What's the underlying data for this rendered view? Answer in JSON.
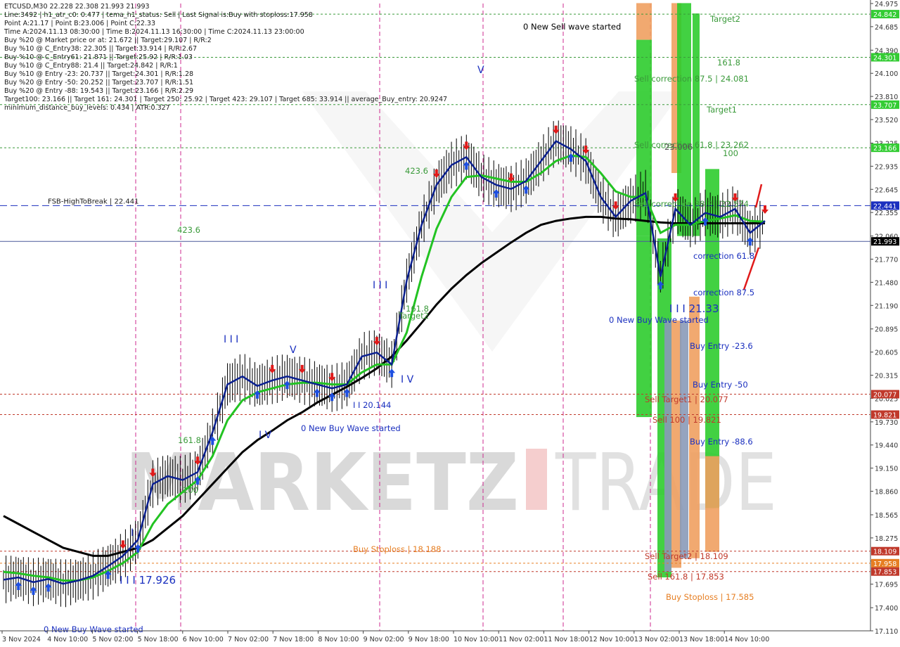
{
  "header": {
    "lines": [
      "ETCUSD,M30  22.228 22.308 21.993 21.993",
      "Line:3492 | h1_atr_c0: 0.477 | tema_h1_status: Sell | Last Signal is:Buy with stoploss:17.958",
      "Point A:21.17 | Point B:23.006 | Point C:22.33",
      "Time A:2024.11.13 08:30:00 | Time B:2024.11.13 16:30:00 | Time C:2024.11.13 23:00:00",
      "Buy %20 @ Market price or at: 21.672 || Target:29.107 | R/R:2",
      "Buy %10 @ C_Entry38: 22.305 || Target:33.914 | R/R:2.67",
      "Buy %10 @ C_Entry61: 21.871 || Target:25.92 | R/R:1.03",
      "Buy %10 @ C_Entry88: 21.4 || Target:24.842 | R/R:1",
      "Buy %10 @ Entry -23: 20.737 || Target:24.301 | R/R:1.28",
      "Buy %20 @ Entry -50: 20.252 || Target:23.707 | R/R:1.51",
      "Buy %20 @ Entry -88: 19.543 || Target:23.166 | R/R:2.29",
      "Target100: 23.166 || Target 161: 24.301 | Target 250: 25.92 | Target 423: 29.107 | Target 685: 33.914 || average_Buy_entry: 20.9247",
      "minimum_distance_buy_levels: 0.434 | ATR:0.327"
    ]
  },
  "chart_data": {
    "type": "line",
    "symbol": "ETCUSD",
    "timeframe": "M30",
    "ylim": [
      17.11,
      24.975
    ],
    "y_ticks": [
      "24.975",
      "24.685",
      "24.390",
      "24.100",
      "23.810",
      "23.520",
      "23.225",
      "22.935",
      "22.645",
      "22.355",
      "22.060",
      "21.770",
      "21.480",
      "21.190",
      "20.895",
      "20.605",
      "20.315",
      "20.025",
      "19.730",
      "19.440",
      "19.150",
      "18.860",
      "18.565",
      "18.275",
      "17.985",
      "17.695",
      "17.400",
      "17.110"
    ],
    "x_labels": [
      "3 Nov 2024",
      "4 Nov 10:00",
      "5 Nov 02:00",
      "5 Nov 18:00",
      "6 Nov 10:00",
      "7 Nov 02:00",
      "7 Nov 18:00",
      "8 Nov 10:00",
      "9 Nov 02:00",
      "9 Nov 18:00",
      "10 Nov 10:00",
      "11 Nov 02:00",
      "11 Nov 18:00",
      "12 Nov 10:00",
      "13 Nov 02:00",
      "13 Nov 18:00",
      "14 Nov 10:00"
    ],
    "series": [
      {
        "values": [
          17.75,
          17.78,
          17.72,
          17.76,
          17.7,
          17.74,
          17.8,
          17.92,
          18.05,
          18.25,
          18.95,
          19.05,
          19.0,
          19.1,
          19.6,
          20.2,
          20.3,
          20.18,
          20.25,
          20.3,
          20.25,
          20.2,
          20.15,
          20.2,
          20.55,
          20.6,
          20.45,
          21.5,
          22.2,
          22.7,
          22.95,
          23.05,
          22.8,
          22.7,
          22.65,
          22.75,
          23.0,
          23.25,
          23.15,
          23.0,
          22.55,
          22.3,
          22.5,
          22.6,
          21.55,
          22.4,
          22.2,
          22.35,
          22.3,
          22.4,
          22.1,
          22.25
        ]
      },
      {
        "values": [
          17.85,
          17.83,
          17.8,
          17.78,
          17.74,
          17.74,
          17.78,
          17.86,
          17.96,
          18.1,
          18.45,
          18.7,
          18.85,
          19.0,
          19.3,
          19.75,
          20.0,
          20.1,
          20.15,
          20.2,
          20.22,
          20.22,
          20.2,
          20.2,
          20.35,
          20.45,
          20.45,
          20.85,
          21.55,
          22.15,
          22.55,
          22.8,
          22.82,
          22.78,
          22.74,
          22.74,
          22.85,
          23.0,
          23.07,
          23.05,
          22.85,
          22.62,
          22.55,
          22.55,
          22.1,
          22.2,
          22.2,
          22.25,
          22.28,
          22.32,
          22.25,
          22.24
        ]
      },
      {
        "values": [
          18.55,
          18.45,
          18.35,
          18.25,
          18.15,
          18.1,
          18.05,
          18.05,
          18.1,
          18.15,
          18.25,
          18.4,
          18.55,
          18.75,
          18.95,
          19.15,
          19.35,
          19.5,
          19.62,
          19.75,
          19.85,
          19.97,
          20.07,
          20.17,
          20.28,
          20.4,
          20.55,
          20.75,
          20.97,
          21.2,
          21.4,
          21.57,
          21.72,
          21.85,
          21.98,
          22.1,
          22.2,
          22.25,
          22.28,
          22.3,
          22.3,
          22.28,
          22.27,
          22.25,
          22.23,
          22.22,
          22.22,
          22.22,
          22.22,
          22.22,
          22.22,
          22.22
        ]
      }
    ],
    "colors": {
      "candles": "#000000",
      "tema": "#0a1f8f",
      "ema_green": "#22c322",
      "sma_black": "#000000",
      "buy_arrow": "#1e4fe0",
      "sell_arrow": "#e01a1a",
      "fib_green": "#2ecc2e",
      "fib_orange": "#f0a060",
      "label_green": "#3a9a3a",
      "label_blue": "#1a2fbf",
      "label_red": "#c0392b"
    },
    "horizontal_levels": [
      {
        "name": "FSB-HighToBreak",
        "value": 22.441,
        "text": "FSB-HighToBreak | 22.441",
        "box": "22.441",
        "color": "#1a2fbf",
        "style": "dashed"
      },
      {
        "value": 21.993,
        "box": "21.993",
        "color": "#4a5a9a",
        "style": "solid",
        "box_bg": "#000000"
      },
      {
        "value": 24.842,
        "box": "24.842",
        "color": "#3a9a3a",
        "style": "dotted",
        "box_bg": "#33cc33"
      },
      {
        "value": 24.301,
        "box": "24.301",
        "color": "#3a9a3a",
        "style": "dotted",
        "box_bg": "#33cc33"
      },
      {
        "value": 23.707,
        "box": "23.707",
        "color": "#3a9a3a",
        "style": "dotted",
        "box_bg": "#33cc33"
      },
      {
        "value": 23.166,
        "box": "23.166",
        "color": "#3a9a3a",
        "style": "dotted",
        "box_bg": "#33cc33"
      },
      {
        "value": 20.077,
        "box": "20.077",
        "color": "#c0392b",
        "style": "dotted",
        "box_bg": "#c0392b"
      },
      {
        "value": 19.821,
        "box": "19.821",
        "color": "#c0392b",
        "style": "dotted",
        "box_bg": "#c0392b"
      },
      {
        "value": 18.109,
        "box": "18.109",
        "color": "#c0392b",
        "style": "dotted",
        "box_bg": "#c0392b"
      },
      {
        "value": 17.958,
        "box": "17.958",
        "color": "#e67e22",
        "style": "dotted",
        "box_bg": "#e67e22"
      },
      {
        "value": 17.853,
        "box": "17.853",
        "color": "#c0392b",
        "style": "dotted",
        "box_bg": "#c0392b"
      }
    ],
    "annotations": [
      {
        "text": "0 New Sell wave started",
        "color": "#000000"
      },
      {
        "text": "Target2",
        "color": "#3a9a3a"
      },
      {
        "text": "161.8",
        "color": "#3a9a3a"
      },
      {
        "text": "Sell correction 87.5 | 24.081",
        "color": "#3a9a3a"
      },
      {
        "text": "Target1",
        "color": "#3a9a3a"
      },
      {
        "text": "Sell correction 61.8 | 23.262",
        "color": "#3a9a3a"
      },
      {
        "text": "23.006",
        "color": "#555555"
      },
      {
        "text": "100",
        "color": "#3a9a3a"
      },
      {
        "text": "423.6",
        "color": "#3a9a3a"
      },
      {
        "text": "423.6",
        "color": "#3a9a3a"
      },
      {
        "text": "Sell correction 38.2 | 22.574",
        "color": "#3a9a3a"
      },
      {
        "text": "correction 61.8",
        "color": "#1a2fbf"
      },
      {
        "text": "correction 87.5",
        "color": "#1a2fbf"
      },
      {
        "text": "I I I 21.33",
        "color": "#1a2fbf"
      },
      {
        "text": "0 New Buy Wave started",
        "color": "#1a2fbf"
      },
      {
        "text": "Buy Entry -23.6",
        "color": "#1a2fbf"
      },
      {
        "text": "Buy Entry -50",
        "color": "#1a2fbf"
      },
      {
        "text": "Sell Target1 | 20.077",
        "color": "#c0392b"
      },
      {
        "text": "Sell 100 | 19.821",
        "color": "#c0392b"
      },
      {
        "text": "Buy Entry -88.6",
        "color": "#1a2fbf"
      },
      {
        "text": "Sell Target2 | 18.109",
        "color": "#c0392b"
      },
      {
        "text": "Sell 161.8 | 17.853",
        "color": "#c0392b"
      },
      {
        "text": "Buy Stoploss | 17.585",
        "color": "#e67e22"
      },
      {
        "text": "Buy Stoploss | 18.188",
        "color": "#e67e22"
      },
      {
        "text": "I I I",
        "color": "#1a2fbf"
      },
      {
        "text": "I V",
        "color": "#1a2fbf"
      },
      {
        "text": "161.8",
        "color": "#3a9a3a"
      },
      {
        "text": "Target2",
        "color": "#3a9a3a"
      },
      {
        "text": "I I 20.144",
        "color": "#1a2fbf"
      },
      {
        "text": "0 New Buy Wave started",
        "color": "#1a2fbf"
      },
      {
        "text": "V",
        "color": "#1a2fbf"
      },
      {
        "text": "I I I",
        "color": "#1a2fbf"
      },
      {
        "text": "I V",
        "color": "#1a2fbf"
      },
      {
        "text": "161.8",
        "color": "#3a9a3a"
      },
      {
        "text": "100",
        "color": "#3a9a3a"
      },
      {
        "text": "I",
        "color": "#1a2fbf"
      },
      {
        "text": "I I I 17.926",
        "color": "#1a2fbf"
      },
      {
        "text": "0 New Buy Wave started",
        "color": "#1a2fbf"
      },
      {
        "text": "V",
        "color": "#1a2fbf"
      }
    ],
    "watermark": "MARKETZ TRADE"
  }
}
